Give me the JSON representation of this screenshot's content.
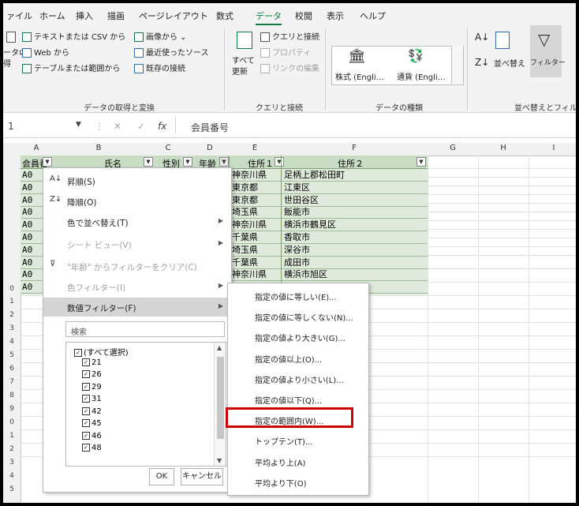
{
  "ribbon_tabs": [
    "ァイル",
    "ホーム",
    "挿入",
    "描画",
    "ページレイアウト",
    "数式",
    "データ",
    "校閲",
    "表示",
    "ヘルプ"
  ],
  "active_tab": "データ",
  "ribbon": {
    "get_data_left": [
      "ータの",
      "得"
    ],
    "from_text_csv": "テキストまたは CSV から",
    "from_web": "Web から",
    "from_table": "テーブルまたは範囲から",
    "from_picture": "画像から",
    "recent_sources": "最近使ったソース",
    "existing_connections": "既存の接続",
    "group_get_transform": "データの取得と変換",
    "refresh_all": [
      "すべて",
      "更新"
    ],
    "queries_connections": "クエリと接続",
    "properties": "プロパティ",
    "edit_links": "リンクの編集",
    "group_queries": "クエリと接続",
    "stocks": "株式 (Engli…",
    "currency": "通貨 (Engli…",
    "group_data_types": "データの種類",
    "sort": "並べ替え",
    "filter": "フィルター",
    "group_sort_filter": "並べ替えとフィルタ"
  },
  "formula_bar": {
    "name_box": "1",
    "fx": "fx",
    "content": "会員番号"
  },
  "columns": [
    "A",
    "B",
    "C",
    "D",
    "E",
    "F",
    "G",
    "H",
    "I"
  ],
  "row_numbers": [
    "",
    "",
    "",
    "",
    "",
    "",
    "",
    "",
    "",
    "",
    "0",
    "1",
    "2",
    "3",
    "4",
    "5",
    "6",
    "7",
    "8",
    "9",
    "0",
    "1",
    "2",
    "3",
    "4",
    "5"
  ],
  "table_headers": [
    "会員番",
    "氏名",
    "性別",
    "年齢",
    "住所１",
    "住所２"
  ],
  "table_rows": [
    {
      "a": "A0",
      "e": "神奈川県",
      "f": "足柄上郡松田町"
    },
    {
      "a": "A0",
      "e": "東京都",
      "f": "江東区"
    },
    {
      "a": "A0",
      "e": "東京都",
      "f": "世田谷区"
    },
    {
      "a": "A0",
      "e": "埼玉県",
      "f": "飯能市"
    },
    {
      "a": "A0",
      "e": "神奈川県",
      "f": "横浜市鶴見区"
    },
    {
      "a": "A0",
      "e": "千葉県",
      "f": "香取市"
    },
    {
      "a": "A0",
      "e": "埼玉県",
      "f": "深谷市"
    },
    {
      "a": "A0",
      "e": "千葉県",
      "f": "成田市"
    },
    {
      "a": "A0",
      "e": "神奈川県",
      "f": "横浜市旭区"
    },
    {
      "a": "A0",
      "e": "",
      "f": ""
    }
  ],
  "filter_menu": {
    "sort_asc": "昇順(S)",
    "sort_desc": "降順(O)",
    "sort_by_color": "色で並べ替え(T)",
    "sheet_view": "シート ビュー(V)",
    "clear_filter": "\"年齢\" からフィルターをクリア(C)",
    "color_filter": "色フィルター(I)",
    "number_filter": "数値フィルター(F)",
    "search_placeholder": "検索",
    "checklist": [
      "(すべて選択)",
      "21",
      "26",
      "29",
      "31",
      "42",
      "45",
      "46",
      "48"
    ],
    "ok": "OK",
    "cancel": "キャンセル"
  },
  "number_filter_submenu": [
    "指定の値に等しい(E)...",
    "指定の値に等しくない(N)...",
    "指定の値より大きい(G)...",
    "指定の値以上(O)...",
    "指定の値より小さい(L)...",
    "指定の値以下(Q)...",
    "指定の範囲内(W)...",
    "トップテン(T)...",
    "平均より上(A)",
    "平均より下(O)"
  ],
  "highlight_color": "#d10000",
  "accent_color": "#107c41"
}
